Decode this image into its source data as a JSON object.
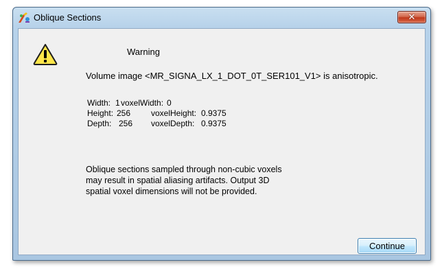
{
  "window": {
    "title": "Oblique Sections",
    "close_icon": "close-icon"
  },
  "dialog": {
    "icon": "warning-icon",
    "heading": "Warning",
    "message": "Volume image <MR_SIGNA_LX_1_DOT_0T_SER101_V1> is anisotropic.",
    "dimensions": [
      {
        "dim_label": "Width:",
        "dim_value": "1",
        "voxel_label": "voxelWidth:",
        "voxel_value": "0"
      },
      {
        "dim_label": "Height:",
        "dim_value": "256",
        "voxel_label": "voxelHeight:",
        "voxel_value": "0.9375"
      },
      {
        "dim_label": "Depth:",
        "dim_value": "256",
        "voxel_label": "voxelDepth:",
        "voxel_value": "0.9375"
      }
    ],
    "note_lines": [
      "Oblique sections sampled through non-cubic voxels",
      "may result in spatial aliasing artifacts. Output 3D",
      "spatial voxel dimensions will not be provided."
    ],
    "continue_label": "Continue"
  },
  "colors": {
    "title_bar": "#b7d2ea",
    "close_button": "#c0391b",
    "client_background": "#f0f0f0",
    "warning_yellow": "#ffe64a"
  }
}
